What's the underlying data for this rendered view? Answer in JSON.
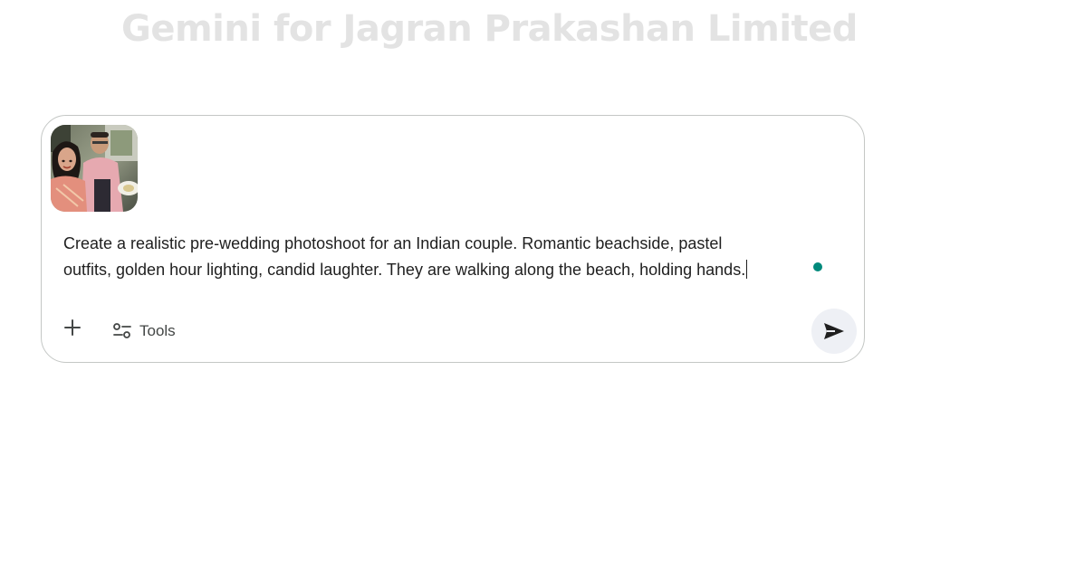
{
  "header": {
    "title": "Gemini for Jagran Prakashan Limited"
  },
  "composer": {
    "attachment": {
      "icon": "image-thumbnail"
    },
    "prompt_line_1": "Create a realistic pre-wedding photoshoot for an Indian couple. Romantic beachside, pastel",
    "prompt_line_2": "outfits, golden hour lighting, candid laughter. They are walking along the beach, holding hands.",
    "status_color": "#00897b",
    "toolbar": {
      "add_icon": "plus-icon",
      "tools_icon": "sliders-icon",
      "tools_label": "Tools",
      "send_icon": "send-icon"
    }
  },
  "colors": {
    "title": "#e3e3e3",
    "border": "#c4c7c5",
    "text": "#1f1f1f",
    "send_bg": "#eef0f5"
  }
}
